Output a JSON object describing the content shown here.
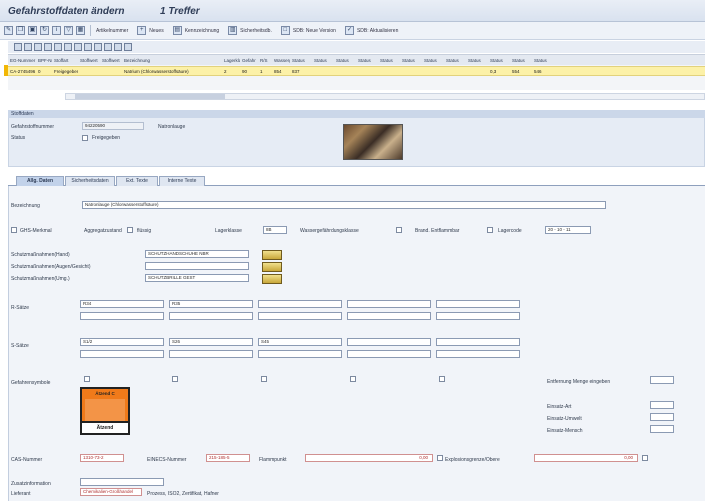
{
  "window": {
    "title": "Gefahrstoffdaten ändern",
    "hits": "1 Treffer"
  },
  "toolbar": {
    "items": [
      "Artikelnummer",
      "Neues",
      "Kennzeichnung",
      "Sicherheitsdb.",
      "SDB: Neue Version",
      "SDB: Aktualisieren"
    ]
  },
  "grid": {
    "headers": [
      "EG-Nummer",
      "BPF-Nr.",
      "Stoffart",
      "Stoffwert",
      "Stoffwert",
      "Bezeichnung",
      "Lagerklasse",
      "Gefahr",
      "R/S",
      "Wassergef.",
      "Status",
      "Status",
      "Status",
      "Status",
      "Status",
      "Status",
      "Status",
      "Status",
      "Status",
      "Status",
      "Status",
      "Status"
    ],
    "row": [
      "CA-2745496",
      "0",
      "Freigegeben",
      "",
      "",
      "Natrium (Chlorwasserstoffsäure)",
      "2",
      "90",
      "1",
      "854",
      "837",
      "",
      "",
      "",
      "",
      "",
      "",
      "",
      "",
      "0,3",
      "554",
      "546"
    ]
  },
  "header_section": {
    "title": "Stoffdaten",
    "label_number": "Gefahrstoffnummer",
    "number_value": "94220590",
    "name_label": "Natronlauge",
    "label_status": "Status",
    "status_value": "Freigegeben"
  },
  "tabs": [
    "Allg. Daten",
    "Sicherheitsdaten",
    "Ext. Texte",
    "Interne Texte"
  ],
  "main": {
    "label_bezeichnung": "Bezeichnung",
    "bezeichnung_value": "Natronlauge (Chlorwasserstoffsäure)",
    "label_gefahrstoff": "GHS-Merkmal",
    "label_aggregat": "Aggregatzustand",
    "aggregat_value": "flüssig",
    "label_lagerklasse": "Lagerklasse",
    "lagerklasse_value": "8B",
    "label_wassergef": "Wassergefährdungsklasse",
    "label_brand": "Brand. Entflammbar",
    "label_lagercode": "Lagercode",
    "lagercode_value": "20 - 10 - 11",
    "label_schutz1": "Schutzmaßnahmen(Hand)",
    "schutz1_value": "SCHUTZHANDSCHUHE NBR",
    "label_schutz2": "Schutzmaßnahmen(Augen/Gesicht)",
    "label_schutz3": "Schutzmaßnahmen(Umg.)",
    "schutz3_value": "SCHUTZBRILLE GEST",
    "label_rsaetze": "R-Sätze",
    "r_values": [
      "R34",
      "R35",
      "",
      "",
      "",
      ""
    ],
    "label_ssaetze": "S-Sätze",
    "s_values": [
      "S1/2",
      "S26",
      "S45",
      "",
      "",
      ""
    ],
    "label_symbole": "Gefahrensymbole",
    "symbol_top": "Ätzend C",
    "symbol_bottom": "Ätzend",
    "label_entfernung": "Entfernung Menge eingeben",
    "label_einsatz1": "Einsatz-Art",
    "label_einsatz2": "Einsatz-Umwelt",
    "label_einsatz3": "Einsatz-Mensch",
    "label_cas": "CAS-Nummer",
    "cas_value": "1310-73-2",
    "label_einecs": "EINECS-Nummer",
    "einecs_value": "215-185-5",
    "label_flammpunkt": "Flammpunkt",
    "flammpunkt_value": "0,00",
    "label_explosion": "Explosionsgrenze/Obere",
    "explosion_value": "0,00",
    "label_zusatz": "Zusatzinformation",
    "label_lieferant": "Lieferant",
    "lieferant_value": "Chemikalien-Großhandel",
    "lieferant_extra": "Prozess, ISO2, Zertifikat, Hafner"
  }
}
